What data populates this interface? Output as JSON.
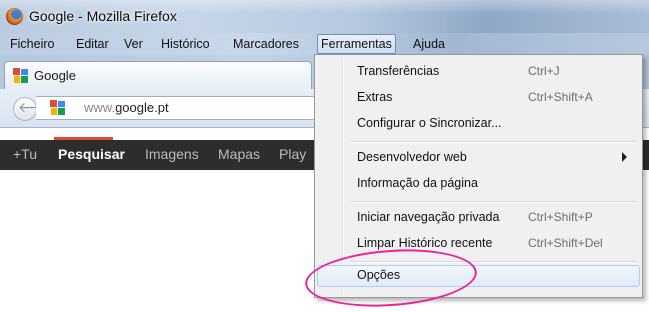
{
  "window": {
    "title": "Google - Mozilla Firefox",
    "icon": "firefox-icon"
  },
  "menubar": {
    "items": [
      "Ficheiro",
      "Editar",
      "Ver",
      "Histórico",
      "Marcadores",
      "Ferramentas",
      "Ajuda"
    ],
    "active": "Ferramentas"
  },
  "tab": {
    "label": "Google",
    "icon": "google-favicon"
  },
  "navbar": {
    "url_prefix": "www.",
    "url_domain": "google.pt",
    "back_icon": "back-arrow-icon"
  },
  "google_bar": {
    "items": [
      "+Tu",
      "Pesquisar",
      "Imagens",
      "Mapas",
      "Play"
    ],
    "selected": "Pesquisar",
    "accent_color": "#dd4b39"
  },
  "dropdown": {
    "items": [
      {
        "label": "Transferências",
        "shortcut": "Ctrl+J"
      },
      {
        "label": "Extras",
        "shortcut": "Ctrl+Shift+A"
      },
      {
        "label": "Configurar o Sincronizar...",
        "shortcut": ""
      },
      {
        "label": "Desenvolvedor web",
        "shortcut": "",
        "submenu": true
      },
      {
        "label": "Informação da página",
        "shortcut": ""
      },
      {
        "label": "Iniciar navegação privada",
        "shortcut": "Ctrl+Shift+P"
      },
      {
        "label": "Limpar Histórico recente",
        "shortcut": "Ctrl+Shift+Del"
      },
      {
        "label": "Opções",
        "shortcut": ""
      }
    ],
    "highlighted": "Opções"
  },
  "annotation_color": "#e8249a"
}
